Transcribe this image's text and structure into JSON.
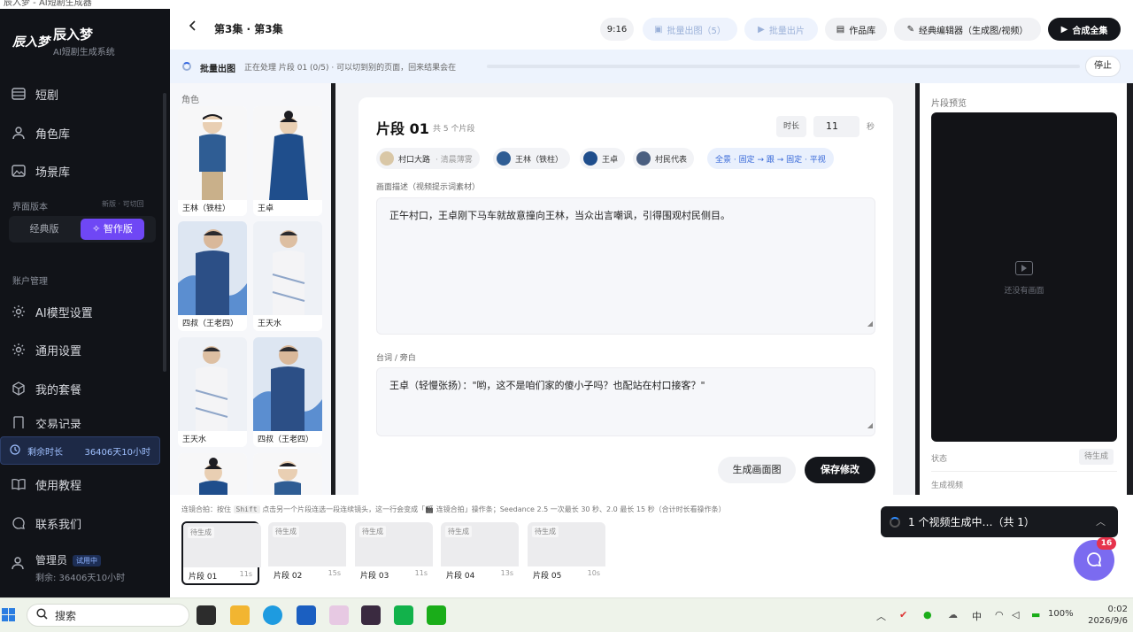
{
  "window_title": "辰入梦 - AI短剧生成器",
  "sidebar": {
    "logo_text": "辰入梦",
    "brand": "辰入梦",
    "subtitle": "AI短剧生成系统",
    "nav": [
      {
        "label": "短剧",
        "icon": "film-icon"
      },
      {
        "label": "角色库",
        "icon": "user-icon"
      },
      {
        "label": "场景库",
        "icon": "image-icon"
      }
    ],
    "interface_label": "界面版本",
    "interface_hint": "新版 · 可切回",
    "version_classic": "经典版",
    "version_smart": "✧ 智作版",
    "account_label": "账户管理",
    "account_nav": [
      {
        "label": "AI模型设置",
        "icon": "gear-icon"
      },
      {
        "label": "通用设置",
        "icon": "settings-icon"
      },
      {
        "label": "我的套餐",
        "icon": "box-icon"
      },
      {
        "label": "交易记录",
        "icon": "receipt-icon"
      }
    ],
    "remain_label": "剩余时长",
    "remain_value": "36406天10小时",
    "bottom_nav": [
      {
        "label": "使用教程",
        "icon": "book-icon"
      },
      {
        "label": "联系我们",
        "icon": "chat-icon"
      }
    ],
    "admin_name": "管理员",
    "admin_badge": "试用中",
    "admin_sub": "剩余: 36406天10小时"
  },
  "topbar": {
    "title": "第3集 · 第3集",
    "ratio": "9:16",
    "batch_image": "批量出图（5）",
    "batch_clip": "批量出片",
    "works": "作品库",
    "classic_editor": "经典编辑器（生成图/视频）",
    "merge": "合成全集"
  },
  "progress": {
    "label": "批量出图",
    "text": "正在处理 片段 01 (0/5) · 可以切到别的页面，回来结果会在",
    "value": 0,
    "stop": "停止"
  },
  "characters": {
    "title": "角色",
    "items": [
      {
        "name": "王林（铁柱）"
      },
      {
        "name": "王卓"
      },
      {
        "name": "四叔（王老四）"
      },
      {
        "name": "王天水"
      },
      {
        "name": "王天水"
      },
      {
        "name": "四叔（王老四）"
      },
      {
        "name": ""
      },
      {
        "name": ""
      }
    ]
  },
  "segment": {
    "title": "片段 01",
    "count": "共 5 个片段",
    "duration_label": "时长",
    "duration": "11",
    "duration_unit": "秒",
    "tags": [
      {
        "label": "村口大路",
        "sub": "· 清晨薄雾"
      },
      {
        "label": "王林（铁柱）",
        "sub": ""
      },
      {
        "label": "王卓",
        "sub": ""
      },
      {
        "label": "村民代表",
        "sub": ""
      }
    ],
    "shot": "全景 · 固定 → 跟 → 固定 · 平视",
    "desc_label": "画面描述（视频提示词素材）",
    "desc": "正午村口，王卓刚下马车就故意撞向王林，当众出言嘲讽，引得围观村民侧目。",
    "dialog_label": "台词 / 旁白",
    "dialog": "王卓（轻慢张扬）：\"哟，这不是咱们家的傻小子吗？也配站在村口接客？\"",
    "gen_btn": "生成画面图",
    "save_btn": "保存修改"
  },
  "preview": {
    "title": "片段预览",
    "empty": "还没有画面",
    "status_label": "状态",
    "status_value": "待生成",
    "video_label": "生成视频"
  },
  "strip": {
    "hint_a": "连镜合拍：按住",
    "hint_key": "Shift",
    "hint_b": "点击另一个片段连选一段连续镜头，这一行会变成「🎬 连镜合拍」操作条；Seedance 2.5 一次最长 30 秒、2.0 最长 15 秒（合计时长看操作条）",
    "clips": [
      {
        "status": "待生成",
        "name": "片段 01",
        "dur": "11s"
      },
      {
        "status": "待生成",
        "name": "片段 02",
        "dur": "15s"
      },
      {
        "status": "待生成",
        "name": "片段 03",
        "dur": "11s"
      },
      {
        "status": "待生成",
        "name": "片段 04",
        "dur": "13s"
      },
      {
        "status": "待生成",
        "name": "片段 05",
        "dur": "10s"
      }
    ]
  },
  "toast": {
    "text": "1 个视频生成中…（共 1）"
  },
  "chat_badge": "16",
  "taskbar": {
    "search": "搜索",
    "ime": "中",
    "battery": "100%",
    "time": "0:02",
    "date": "2026/9/6"
  }
}
